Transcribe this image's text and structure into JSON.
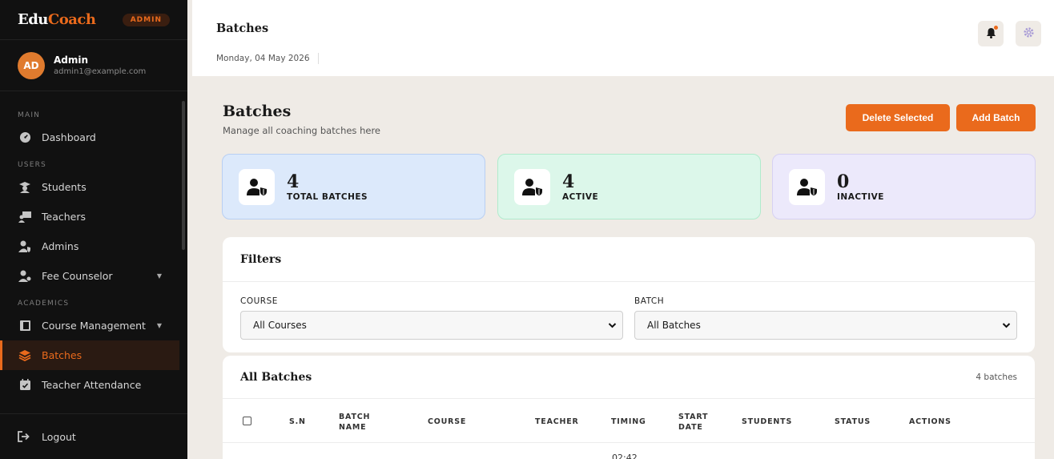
{
  "brand": {
    "part1": "Edu",
    "part2": "Coach",
    "badge": "ADMIN"
  },
  "user": {
    "initials": "AD",
    "name": "Admin",
    "email": "admin1@example.com"
  },
  "nav": {
    "section_main": "MAIN",
    "section_users": "USERS",
    "section_academics": "ACADEMICS",
    "dashboard": "Dashboard",
    "students": "Students",
    "teachers": "Teachers",
    "admins": "Admins",
    "fee_counselor": "Fee Counselor",
    "course_management": "Course Management",
    "batches": "Batches",
    "teacher_attendance": "Teacher Attendance",
    "logout": "Logout"
  },
  "topbar": {
    "title": "Batches",
    "date": "Monday, 04 May 2026"
  },
  "page": {
    "title": "Batches",
    "subtitle": "Manage all coaching batches here",
    "delete_selected": "Delete Selected",
    "add_batch": "Add Batch"
  },
  "stats": [
    {
      "value": "4",
      "label": "TOTAL BATCHES"
    },
    {
      "value": "4",
      "label": "ACTIVE"
    },
    {
      "value": "0",
      "label": "INACTIVE"
    }
  ],
  "filters": {
    "title": "Filters",
    "course_label": "COURSE",
    "course_value": "All Courses",
    "batch_label": "BATCH",
    "batch_value": "All Batches"
  },
  "table": {
    "title": "All Batches",
    "count": "4 batches",
    "columns": {
      "sn": "S.N",
      "batch_name_1": "BATCH",
      "batch_name_2": "NAME",
      "course": "COURSE",
      "teacher": "TEACHER",
      "timing": "TIMING",
      "start_date_1": "START",
      "start_date_2": "DATE",
      "students": "STUDENTS",
      "status": "STATUS",
      "actions": "ACTIONS"
    },
    "first_row_timing_partial": "02:42"
  },
  "colors": {
    "accent": "#ea6a1c",
    "sidebar_bg": "#111111",
    "page_bg": "#efebe6"
  },
  "icons": [
    "dashboard-icon",
    "graduation-cap-icon",
    "chalkboard-teacher-icon",
    "user-shield-icon",
    "user-tie-icon",
    "book-icon",
    "layers-icon",
    "calendar-check-icon",
    "logout-icon",
    "bell-icon",
    "gear-icon",
    "chevron-down-icon"
  ]
}
